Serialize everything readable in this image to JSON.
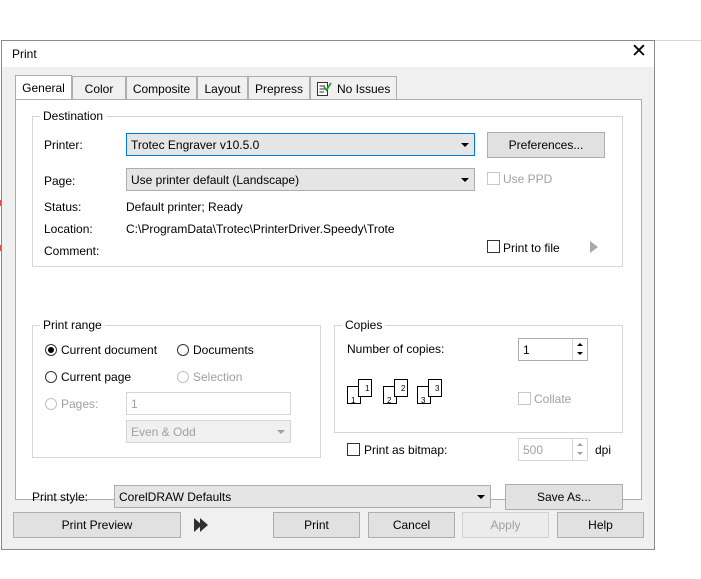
{
  "window": {
    "title": "Print",
    "close_glyph": "✕"
  },
  "tabs": [
    {
      "label": "General"
    },
    {
      "label": "Color"
    },
    {
      "label": "Composite"
    },
    {
      "label": "Layout"
    },
    {
      "label": "Prepress"
    },
    {
      "label": "No Issues",
      "icon": "checklist-icon"
    }
  ],
  "destination": {
    "title": "Destination",
    "printer_label": "Printer:",
    "printer_value": "Trotec Engraver v10.5.0",
    "preferences_button": "Preferences...",
    "page_label": "Page:",
    "page_value": "Use printer default (Landscape)",
    "use_ppd_label": "Use PPD",
    "status_label": "Status:",
    "status_value": "Default printer; Ready",
    "location_label": "Location:",
    "location_value": "C:\\ProgramData\\Trotec\\PrinterDriver.Speedy\\Trote",
    "comment_label": "Comment:",
    "print_to_file_label": "Print to file"
  },
  "print_range": {
    "title": "Print range",
    "current_document": "Current document",
    "documents": "Documents",
    "current_page": "Current page",
    "selection": "Selection",
    "pages_label": "Pages:",
    "pages_value": "1",
    "even_odd_value": "Even & Odd",
    "selected": "current_document"
  },
  "copies": {
    "title": "Copies",
    "number_label": "Number of copies:",
    "number_value": "1",
    "collate_label": "Collate",
    "page_icons": [
      "1",
      "1",
      "2",
      "2",
      "3",
      "3"
    ]
  },
  "bitmap": {
    "label": "Print as bitmap:",
    "dpi_value": "500",
    "dpi_unit": "dpi"
  },
  "print_style": {
    "label": "Print style:",
    "value": "CorelDRAW Defaults",
    "save_as_button": "Save As..."
  },
  "footer": {
    "print_preview": "Print Preview",
    "print": "Print",
    "cancel": "Cancel",
    "apply": "Apply",
    "help": "Help"
  },
  "colors": {
    "focus_border": "#0078d7",
    "disabled_text": "#a0a0a0",
    "dialog_bg": "#f0f0f0"
  }
}
